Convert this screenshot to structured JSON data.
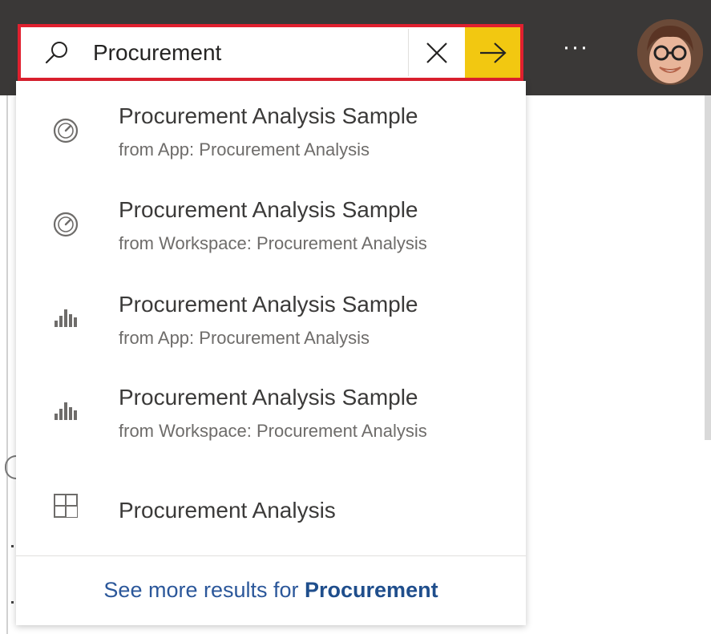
{
  "search": {
    "value": "Procurement",
    "clear_icon": "close-icon",
    "go_icon": "arrow-right-icon",
    "search_icon": "search-icon"
  },
  "header": {
    "more_label": "···",
    "avatar_icon": "user-avatar"
  },
  "results": [
    {
      "title": "Procurement Analysis Sample",
      "subtitle": "from App: Procurement Analysis",
      "icon": "dashboard-icon"
    },
    {
      "title": "Procurement Analysis Sample",
      "subtitle": "from Workspace: Procurement Analysis",
      "icon": "dashboard-icon"
    },
    {
      "title": "Procurement Analysis Sample",
      "subtitle": "from App: Procurement Analysis",
      "icon": "report-icon"
    },
    {
      "title": "Procurement Analysis Sample",
      "subtitle": "from Workspace: Procurement Analysis",
      "icon": "report-icon"
    },
    {
      "title": "Procurement Analysis",
      "icon": "workspace-icon"
    }
  ],
  "see_more": {
    "prefix": "See more results for ",
    "term": "Procurement"
  },
  "colors": {
    "topbar": "#3a3837",
    "highlight_border": "#e0202f",
    "go_button": "#f2c811",
    "link": "#2b579a"
  }
}
